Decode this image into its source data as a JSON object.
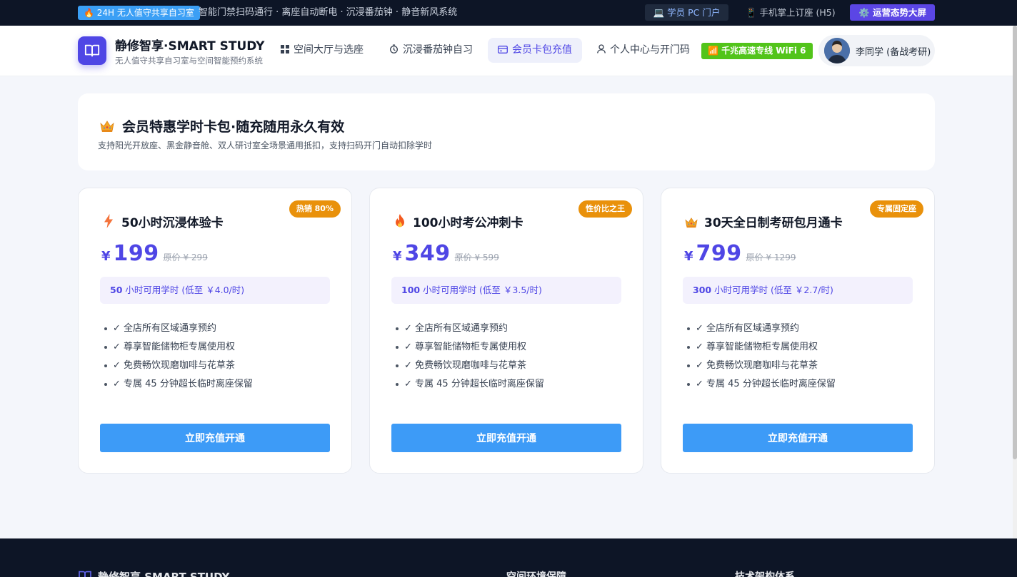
{
  "topbar": {
    "badge": "🔥 24H 无人值守共享自习室",
    "features": "智能门禁扫码通行 · 离座自动断电 · 沉浸番茄钟 · 静音新风系统",
    "pc_portal": "💻 学员 PC 门户",
    "h5": "📱 手机掌上订座 (H5)",
    "ops": "⚙️ 运营态势大屏"
  },
  "header": {
    "brand_title": "静修智享·SMART STUDY",
    "brand_sub": "无人值守共享自习室与空间智能预约系统",
    "nav": [
      {
        "label": "空间大厅与选座",
        "icon": "grid-icon"
      },
      {
        "label": "沉浸番茄钟自习",
        "icon": "timer-icon"
      },
      {
        "label": "会员卡包充值",
        "icon": "card-icon",
        "active": true
      },
      {
        "label": "个人中心与开门码",
        "icon": "user-icon"
      }
    ],
    "wifi": "📶 千兆高速专线 WiFi 6",
    "user_name": "李同学 (备战考研)"
  },
  "intro": {
    "title": "会员特惠学时卡包·随充随用永久有效",
    "desc": "支持阳光开放座、黑金静音舱、双人研讨室全场景通用抵扣，支持扫码开门自动扣除学时"
  },
  "plans": [
    {
      "tag": "热销 80%",
      "name": "50小时沉浸体验卡",
      "icon": "lightning-icon",
      "currency": "¥",
      "price": "199",
      "original": "原价 ¥ 299",
      "hours": "50",
      "quota_text": "小时可用学时 (低至 ￥4.0/时)",
      "features": [
        "✓ 全店所有区域通享预约",
        "✓ 尊享智能储物柜专属使用权",
        "✓ 免费畅饮现磨咖啡与花草茶",
        "✓ 专属 45 分钟超长临时离座保留"
      ],
      "button": "立即充值开通"
    },
    {
      "tag": "性价比之王",
      "name": "100小时考公冲刺卡",
      "icon": "flame-icon",
      "currency": "¥",
      "price": "349",
      "original": "原价 ¥ 599",
      "hours": "100",
      "quota_text": "小时可用学时 (低至 ￥3.5/时)",
      "features": [
        "✓ 全店所有区域通享预约",
        "✓ 尊享智能储物柜专属使用权",
        "✓ 免费畅饮现磨咖啡与花草茶",
        "✓ 专属 45 分钟超长临时离座保留"
      ],
      "button": "立即充值开通"
    },
    {
      "tag": "专属固定座",
      "name": "30天全日制考研包月通卡",
      "icon": "crown-icon",
      "currency": "¥",
      "price": "799",
      "original": "原价 ¥ 1299",
      "hours": "300",
      "quota_text": "小时可用学时 (低至 ￥2.7/时)",
      "features": [
        "✓ 全店所有区域通享预约",
        "✓ 尊享智能储物柜专属使用权",
        "✓ 免费畅饮现磨咖啡与花草茶",
        "✓ 专属 45 分钟超长临时离座保留"
      ],
      "button": "立即充值开通"
    }
  ],
  "footer": {
    "brand": "静修智享 SMART STUDY",
    "col1": "空间环境保障",
    "col2": "技术架构体系"
  },
  "colors": {
    "accent": "#4f46e5",
    "button": "#3d9bf7",
    "tag": "#e9910b",
    "dark": "#0d1526"
  }
}
